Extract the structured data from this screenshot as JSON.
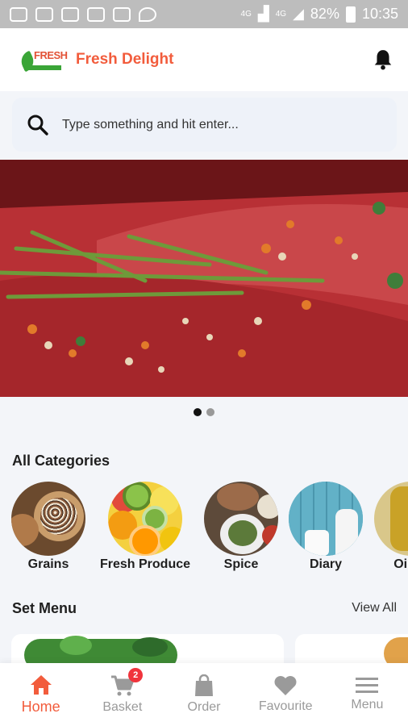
{
  "status_bar": {
    "network_label": "4G",
    "network_label2": "4G",
    "battery": "82%",
    "time": "10:35"
  },
  "header": {
    "logo_text": "FRESH",
    "brand": "Fresh Delight"
  },
  "search": {
    "placeholder": "Type something and hit enter..."
  },
  "banner": {
    "slides": 2,
    "active_slide": 1
  },
  "categories": {
    "title": "All Categories",
    "items": [
      {
        "label": "Grains"
      },
      {
        "label": "Fresh Produce"
      },
      {
        "label": "Spice"
      },
      {
        "label": "Diary"
      },
      {
        "label": "Oils a"
      }
    ]
  },
  "set_menu": {
    "title": "Set Menu",
    "view_all": "View All"
  },
  "bottom_nav": {
    "items": [
      {
        "label": "Home",
        "icon": "home-icon",
        "active": true
      },
      {
        "label": "Basket",
        "icon": "cart-icon",
        "badge": "2"
      },
      {
        "label": "Order",
        "icon": "bag-icon"
      },
      {
        "label": "Favourite",
        "icon": "heart-icon"
      },
      {
        "label": "Menu",
        "icon": "menu-icon"
      }
    ]
  },
  "colors": {
    "accent": "#f25c3c",
    "badge": "#f0343c",
    "background": "#f3f5f9"
  }
}
